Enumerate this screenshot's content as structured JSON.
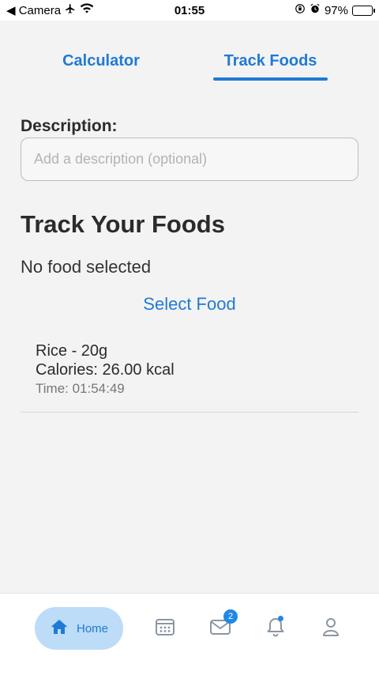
{
  "status_bar": {
    "back_label": "◀ Camera",
    "time": "01:55",
    "battery": "97%",
    "battery_level": 0.97
  },
  "tabs": [
    {
      "label": "Calculator",
      "active": false
    },
    {
      "label": "Track Foods",
      "active": true
    }
  ],
  "description": {
    "label": "Description:",
    "placeholder": "Add a description (optional)",
    "value": ""
  },
  "track": {
    "title": "Track Your Foods",
    "no_food": "No food selected",
    "select_button": "Select Food"
  },
  "entries": [
    {
      "name": "Rice - 20g",
      "calories": "Calories: 26.00 kcal",
      "time": "Time: 01:54:49"
    }
  ],
  "bottom_nav": {
    "home_label": "Home",
    "mail_badge": "2",
    "items": [
      "home-icon",
      "calendar-icon",
      "mail-icon",
      "bell-icon",
      "user-icon"
    ]
  },
  "colors": {
    "accent": "#1f7ad6",
    "home_pill": "#bcdcf7",
    "background": "#f3f3f3"
  }
}
